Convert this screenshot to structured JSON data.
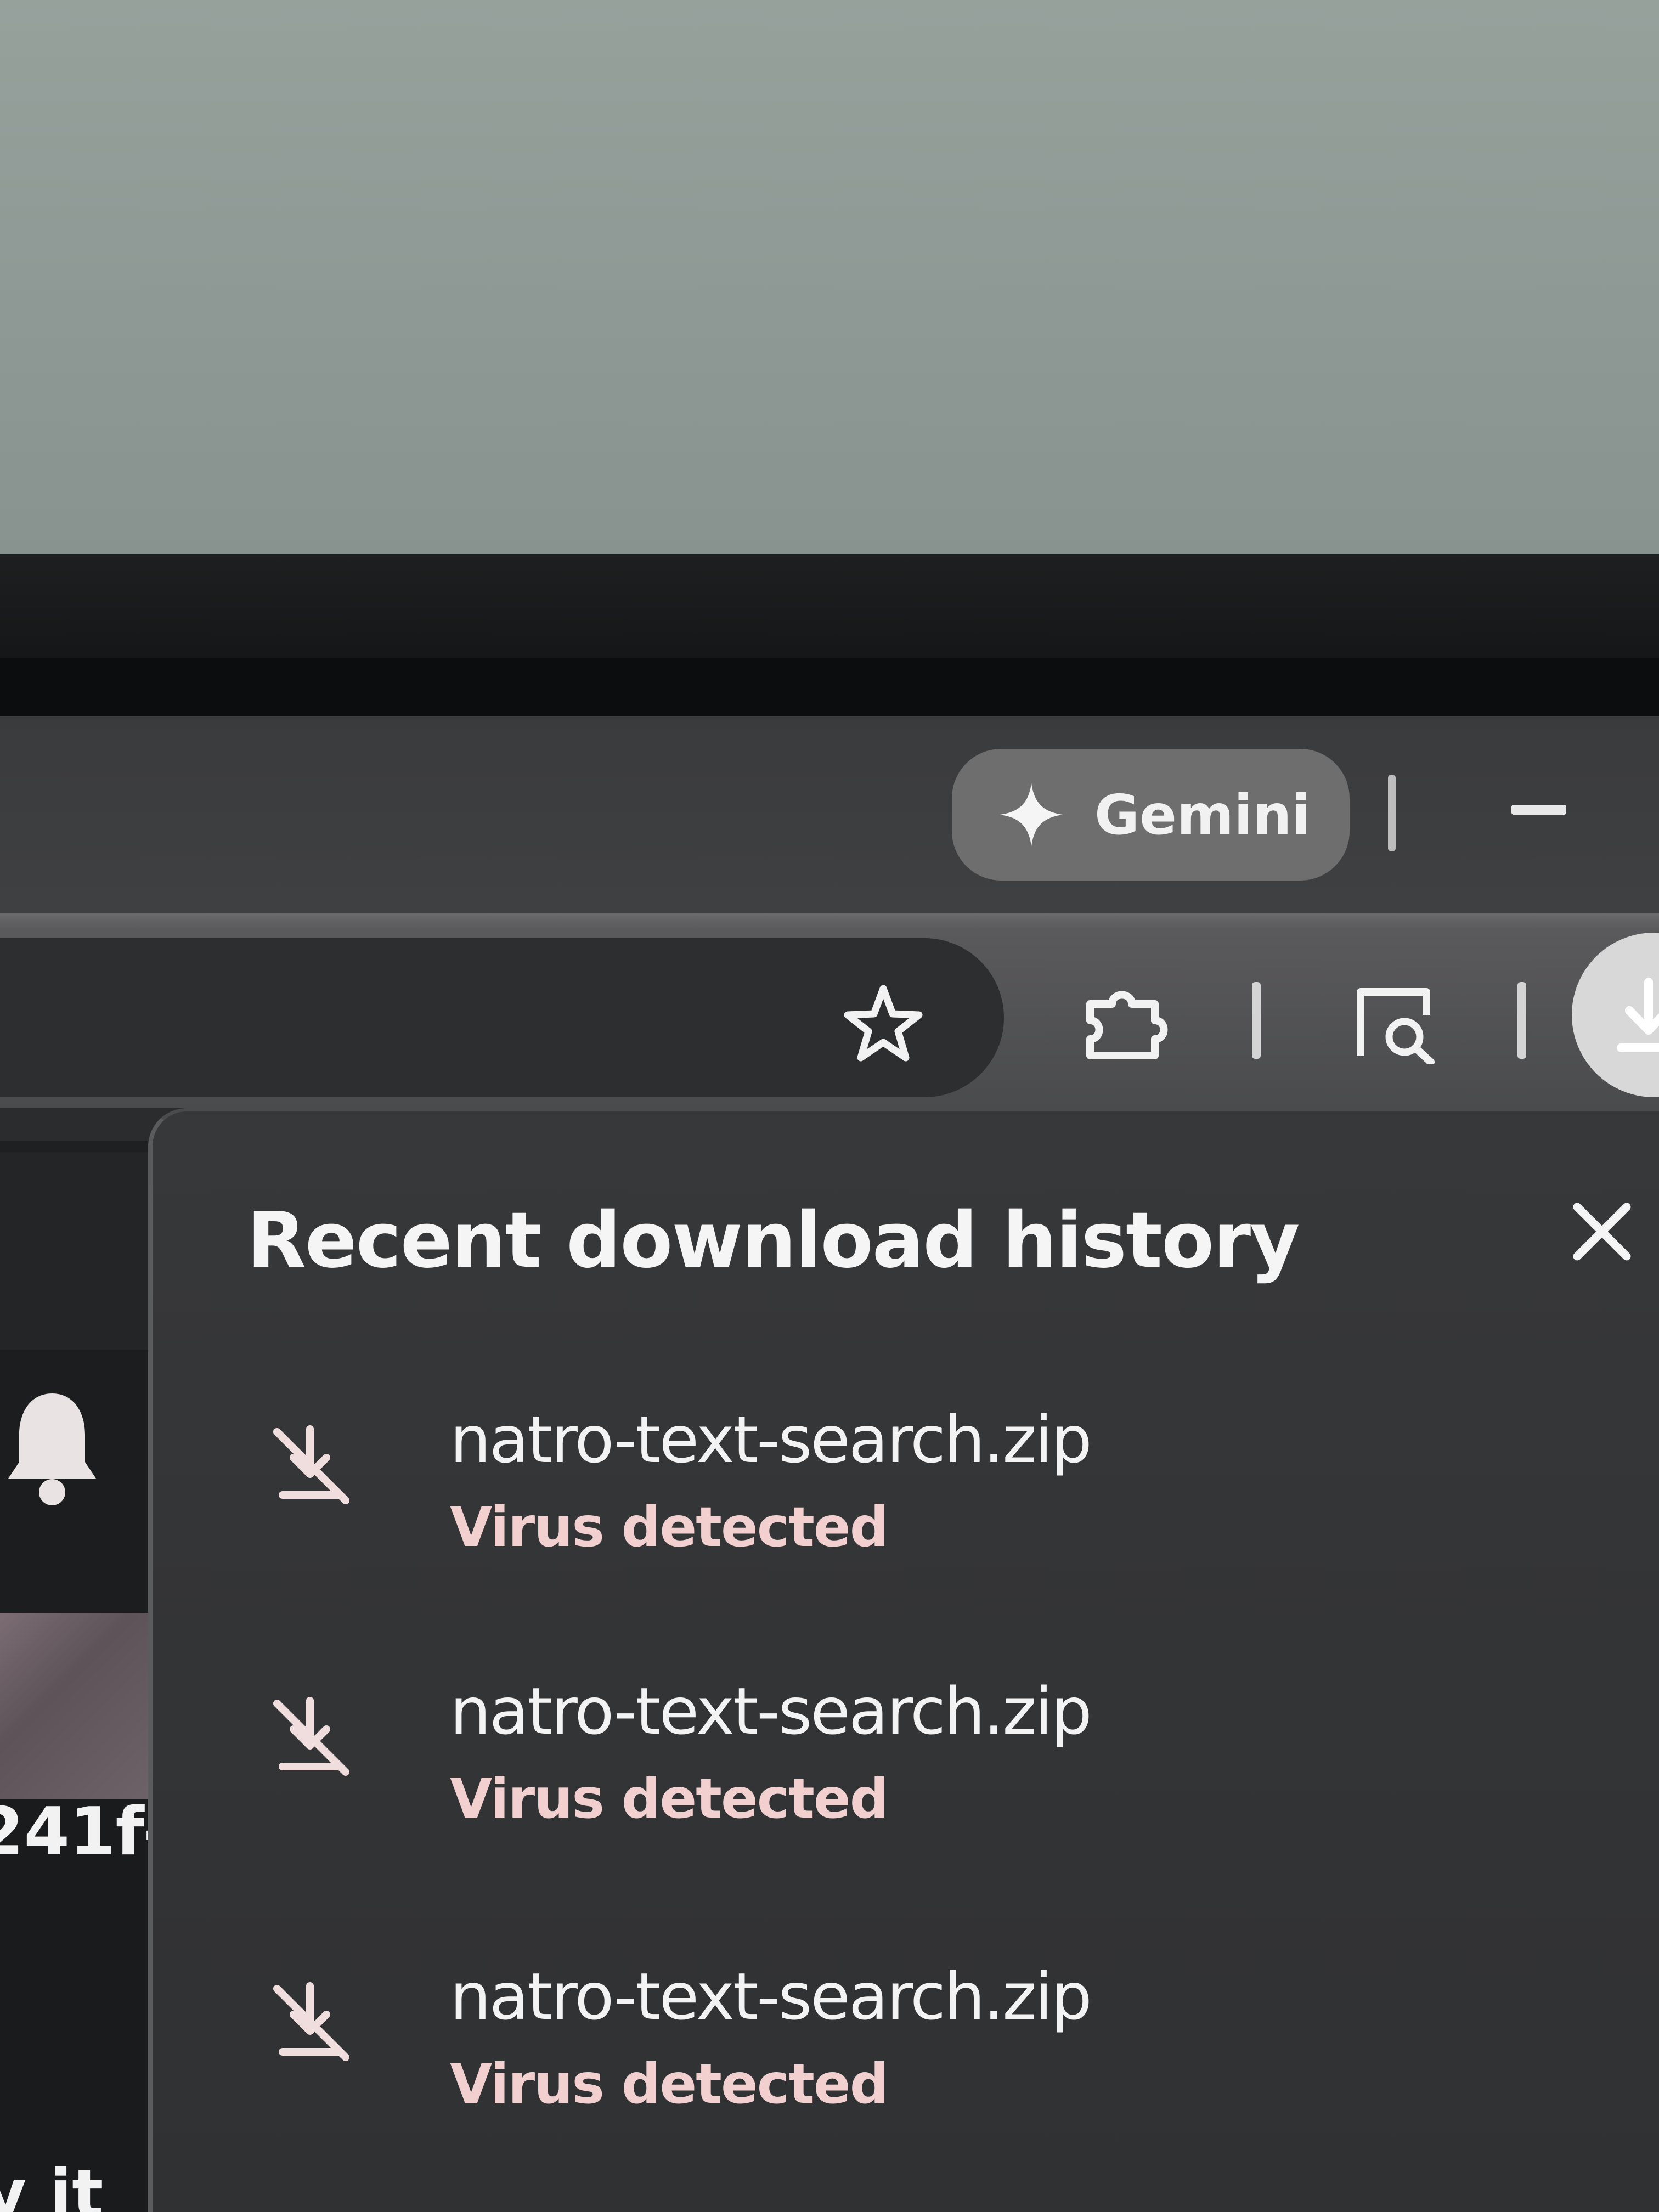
{
  "toolbar": {
    "gemini_label": "Gemini"
  },
  "downloads_bubble": {
    "title": "Recent download history",
    "items": [
      {
        "filename": "natro-text-search.zip",
        "status": "Virus detected"
      },
      {
        "filename": "natro-text-search.zip",
        "status": "Virus detected"
      },
      {
        "filename": "natro-text-search.zip",
        "status": "Virus detected"
      }
    ]
  },
  "background_page": {
    "visible_text_fragment": "241f-",
    "visible_text_fragment_2": "y it"
  },
  "colors": {
    "status_warning": "#f1d0cf",
    "bubble_background": "#333436",
    "gemini_button": "#6e6e6e"
  }
}
